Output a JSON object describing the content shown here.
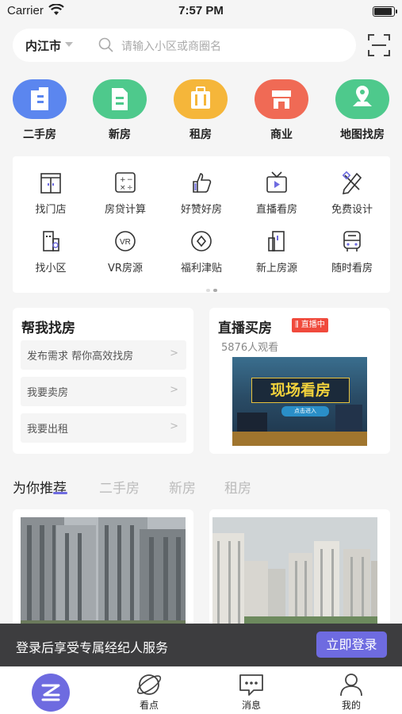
{
  "status": {
    "carrier": "Carrier",
    "time": "7:57 PM"
  },
  "search": {
    "city": "内江市",
    "placeholder": "请输入小区或商圈名"
  },
  "categories": [
    {
      "label": "二手房",
      "color": "#5b86ef",
      "icon": "building-icon"
    },
    {
      "label": "新房",
      "color": "#4ec98c",
      "icon": "new-building-icon"
    },
    {
      "label": "租房",
      "color": "#f5b63a",
      "icon": "luggage-icon"
    },
    {
      "label": "商业",
      "color": "#f06a55",
      "icon": "shop-icon"
    },
    {
      "label": "地图找房",
      "color": "#4ec98c",
      "icon": "map-pin-icon"
    }
  ],
  "grid": [
    {
      "label": "找门店",
      "icon": "store-door-icon"
    },
    {
      "label": "房贷计算",
      "icon": "calculator-icon"
    },
    {
      "label": "好赞好房",
      "icon": "thumbs-up-icon"
    },
    {
      "label": "直播看房",
      "icon": "tv-play-icon"
    },
    {
      "label": "免费设计",
      "icon": "design-tools-icon"
    },
    {
      "label": "找小区",
      "icon": "community-icon"
    },
    {
      "label": "VR房源",
      "icon": "vr-icon"
    },
    {
      "label": "福利津贴",
      "icon": "welfare-icon"
    },
    {
      "label": "新上房源",
      "icon": "new-listing-icon"
    },
    {
      "label": "随时看房",
      "icon": "bus-icon"
    }
  ],
  "help": {
    "title": "帮我找房",
    "items": [
      "发布需求 帮你高效找房",
      "我要卖房",
      "我要出租"
    ],
    "chevron": ">"
  },
  "live": {
    "title": "直播买房",
    "badge": "直播中",
    "viewers": "5876人观看",
    "banner": "现场看房",
    "banner_sub": "点击进入"
  },
  "feed_tabs": [
    "为你推荐",
    "二手房",
    "新房",
    "租房"
  ],
  "login_banner": {
    "text": "登录后享受专属经纪人服务",
    "button": "立即登录"
  },
  "tabbar": [
    {
      "label": "",
      "icon": "home-logo-icon"
    },
    {
      "label": "看点",
      "icon": "planet-icon"
    },
    {
      "label": "消息",
      "icon": "message-icon"
    },
    {
      "label": "我的",
      "icon": "user-icon"
    }
  ],
  "colors": {
    "accent": "#6e6be0",
    "live_red": "#f04a3c"
  }
}
